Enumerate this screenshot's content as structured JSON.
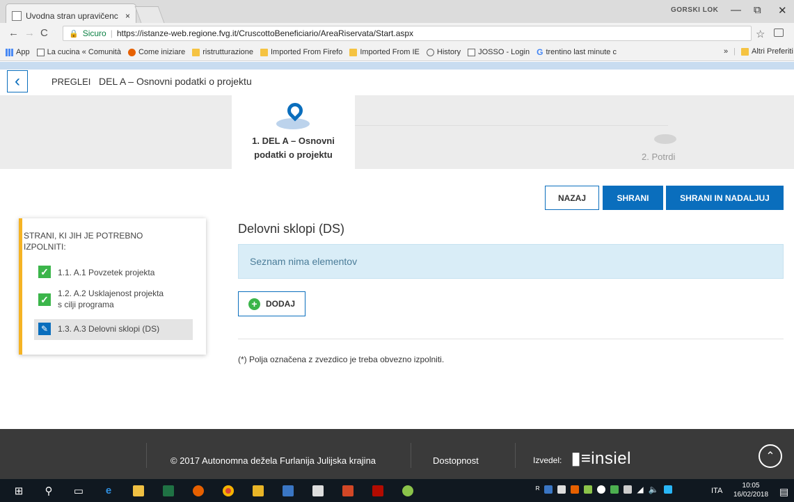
{
  "browser": {
    "tab_title": "Uvodna stran upravičenc",
    "tab_close": "×",
    "profile": "GORSKI LOK",
    "window_controls": [
      "—",
      "⧉",
      "✕"
    ],
    "secure_label": "Sicuro",
    "url": "https://istanze-web.regione.fvg.it/CruscottoBeneficiario/AreaRiservata/Start.aspx",
    "bookmarks": [
      {
        "icon": "apps-grid-icon",
        "label": "App"
      },
      {
        "icon": "page-icon",
        "label": "La cucina « Comunità"
      },
      {
        "icon": "firefox-icon",
        "label": "Come iniziare"
      },
      {
        "icon": "folder-icon",
        "label": "ristrutturazione"
      },
      {
        "icon": "folder-icon",
        "label": "Imported From Firefo"
      },
      {
        "icon": "folder-icon",
        "label": "Imported From IE"
      },
      {
        "icon": "history-icon",
        "label": "History"
      },
      {
        "icon": "page-icon",
        "label": "JOSSO - Login"
      },
      {
        "icon": "google-icon",
        "label": "trentino last minute c"
      }
    ],
    "bookmarks_more": "»",
    "other_bookmarks": "Altri Preferiti"
  },
  "header": {
    "back_glyph": "‹",
    "breadcrumb_pregled": "PREGLEI",
    "breadcrumb_current": "DEL A – Osnovni podatki o projektu"
  },
  "stepper": {
    "step1_line1": "1. DEL A – Osnovni",
    "step1_line2": "podatki o projektu",
    "step2": "2. Potrdi"
  },
  "actions": {
    "back": "NAZAJ",
    "save": "SHRANI",
    "save_continue": "SHRANI IN NADALJUJ"
  },
  "sidebar": {
    "title_line1": "STRANI, KI JIH JE POTREBNO",
    "title_line2": "IZPOLNITI:",
    "items": [
      {
        "label": "1.1. A.1 Povzetek projekta",
        "status": "done"
      },
      {
        "label_line1": "1.2. A.2 Usklajenost projekta",
        "label_line2": "s cilji programa",
        "status": "done"
      },
      {
        "label": "1.3. A.3 Delovni sklopi (DS)",
        "status": "current"
      }
    ]
  },
  "main": {
    "section_title": "Delovni sklopi (DS)",
    "empty_message": "Seznam nima elementov",
    "add_button": "DODAJ",
    "required_note": "(*) Polja označena z zvezdico je treba obvezno izpolniti."
  },
  "footer": {
    "copyright": "© 2017 Autonomna dežela Furlanija Julijska krajina",
    "accessibility": "Dostopnost",
    "made_by": "Izvedel:",
    "logo_text": "insiel",
    "to_top": "⌃"
  },
  "taskbar": {
    "language": "ITA",
    "time": "10:05",
    "date": "16/02/2018"
  },
  "colors": {
    "primary": "#0a6ebd",
    "accent_bar": "#f5b324",
    "check_green": "#3bb54a",
    "info_bg": "#d9edf7",
    "footer_bg": "#3a3a3a"
  }
}
